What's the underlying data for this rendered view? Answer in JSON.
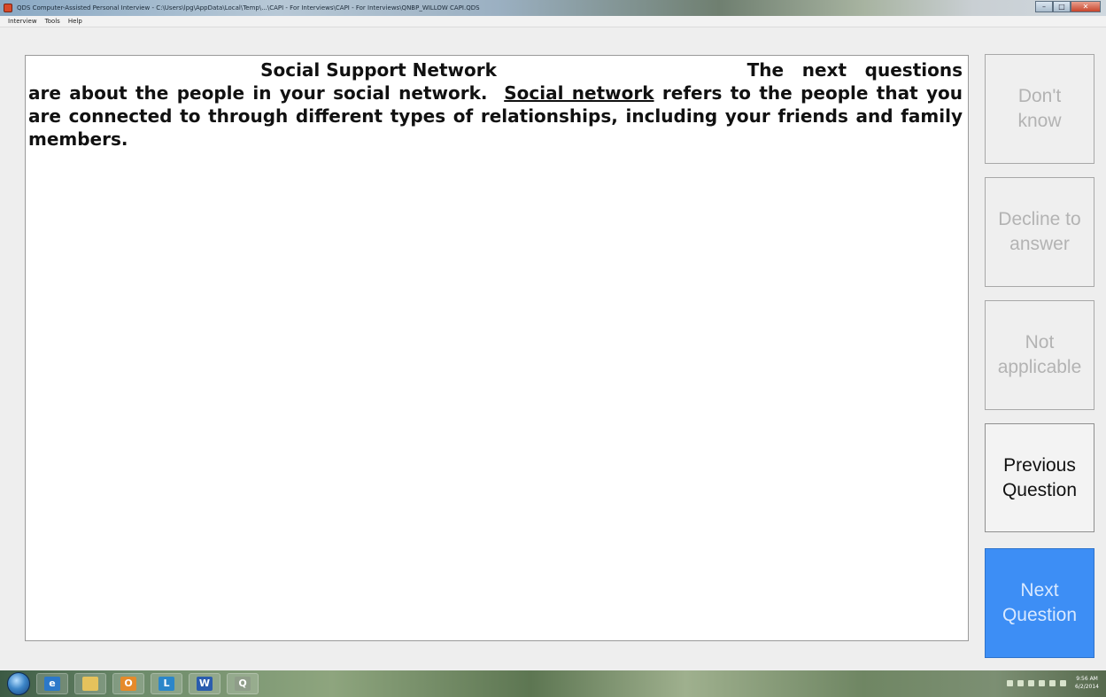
{
  "window": {
    "title": "QDS Computer-Assisted Personal Interview - C:\\Users\\lpg\\AppData\\Local\\Temp\\...\\CAPI - For Interviews\\CAPI - For Interviews\\QNBP_WILLOW CAPI.QDS",
    "controls": {
      "minimize": "–",
      "maximize": "□",
      "close": "✕"
    }
  },
  "menu": {
    "items": [
      "Interview",
      "Tools",
      "Help"
    ]
  },
  "question": {
    "title": "Social Support Network",
    "text_before_link": "The next questions are about the people in your social network.",
    "link_term": "Social network",
    "text_after_link": "refers to the people that you are connected to through different types of relationships, including your friends and family members."
  },
  "buttons": {
    "dont_know": {
      "line1": "Don't",
      "line2": "know"
    },
    "decline": {
      "line1": "Decline to",
      "line2": "answer"
    },
    "not_applicable": {
      "line1": "Not",
      "line2": "applicable"
    },
    "previous": {
      "line1": "Previous",
      "line2": "Question"
    },
    "next": {
      "line1": "Next",
      "line2": "Question"
    }
  },
  "taskbar": {
    "icons": [
      {
        "name": "internet-explorer-icon",
        "glyph": "e",
        "color": "#2b78c9"
      },
      {
        "name": "file-explorer-icon",
        "glyph": "",
        "color": "#e5c25c"
      },
      {
        "name": "outlook-icon",
        "glyph": "O",
        "color": "#e58a2a"
      },
      {
        "name": "lync-icon",
        "glyph": "L",
        "color": "#2b86c9"
      },
      {
        "name": "word-icon",
        "glyph": "W",
        "color": "#2a5cae"
      },
      {
        "name": "qds-app-icon",
        "glyph": "Q",
        "color": "#8f9d89"
      }
    ],
    "clock": {
      "time": "9:56 AM",
      "date": "6/2/2014"
    }
  },
  "colors": {
    "primary_button": "#3d8ef5",
    "disabled_text": "#b3b3b3"
  }
}
